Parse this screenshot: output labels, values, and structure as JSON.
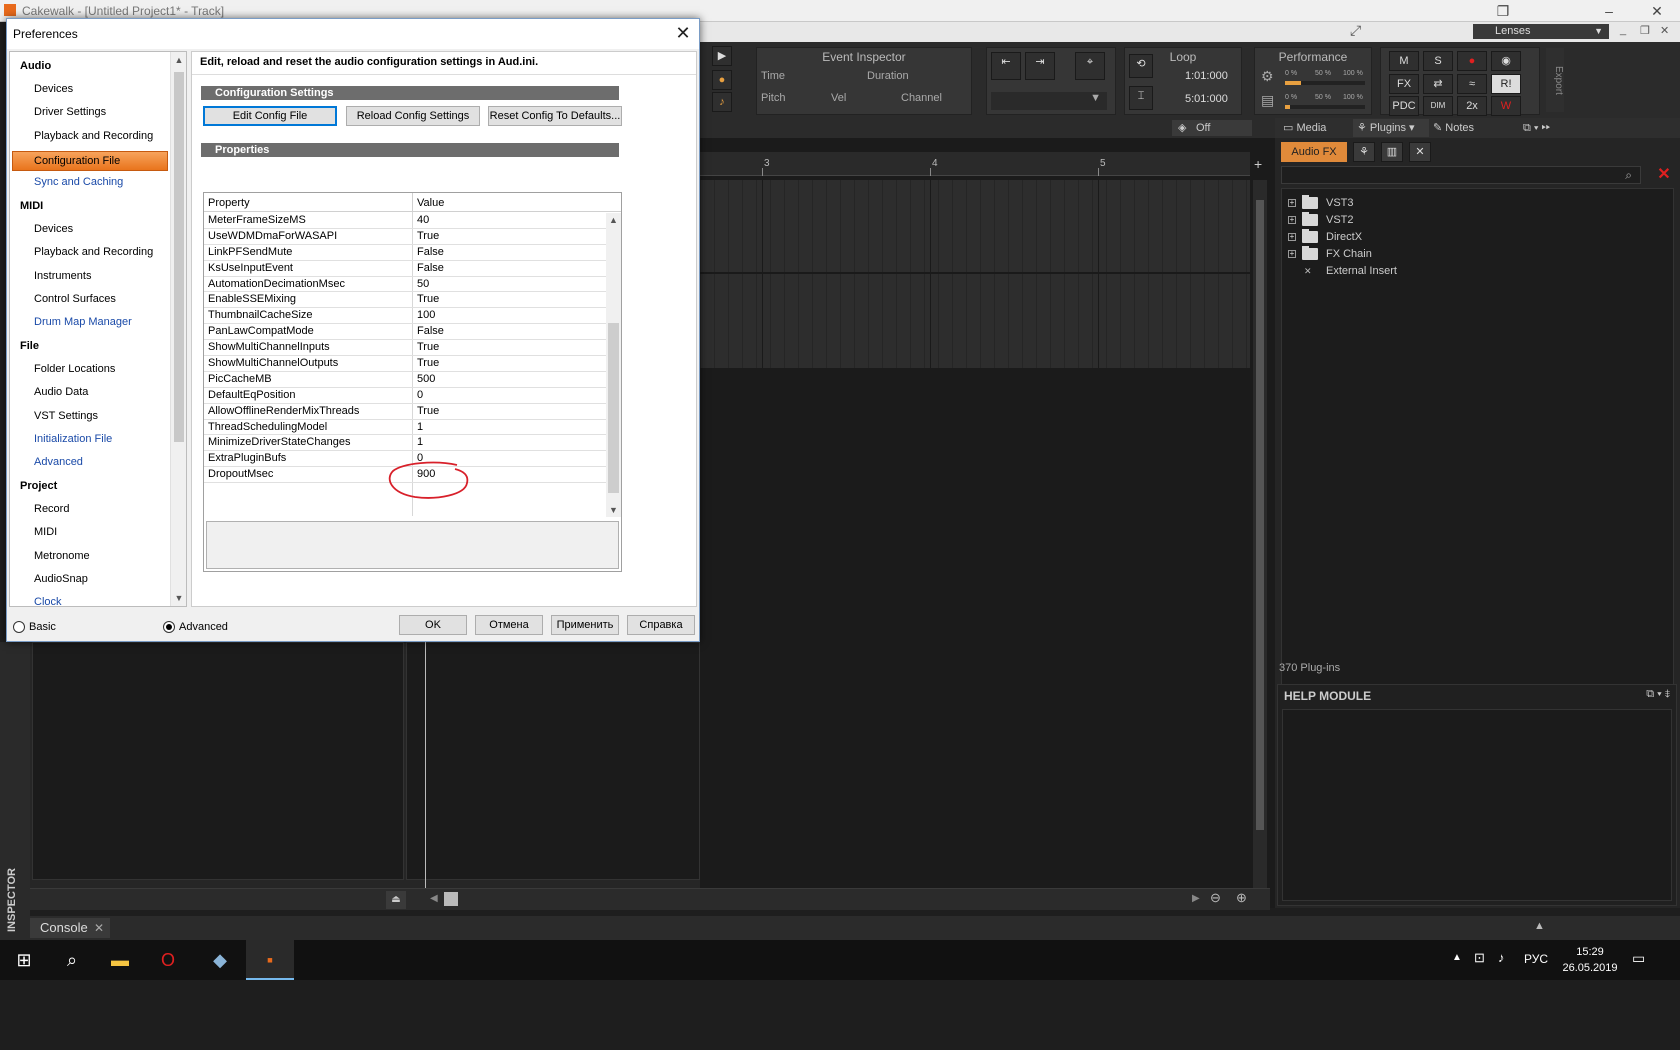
{
  "app": {
    "title": "Cakewalk - [Untitled Project1* - Track]",
    "lens_label": "Lenses",
    "export_label": "Export"
  },
  "controlbar": {
    "event_inspector": {
      "title": "Event Inspector",
      "time": "Time",
      "duration": "Duration",
      "pitch": "Pitch",
      "vel": "Vel",
      "channel": "Channel"
    },
    "loop": {
      "title": "Loop",
      "start": "1:01:000",
      "end": "5:01:000"
    },
    "performance": {
      "title": "Performance",
      "cpu1": "0 %",
      "cpu1_mid": "50 %",
      "cpu1_max": "100 %",
      "cpu2": "0 %",
      "cpu2_mid": "50 %",
      "cpu2_max": "100 %"
    },
    "mix": {
      "m": "M",
      "s": "S",
      "fx": "FX",
      "ri": "R!",
      "pdc": "PDC",
      "dim": "DIM",
      "x2": "2x"
    }
  },
  "track_view": {
    "off_label": "Off",
    "ruler": [
      "3",
      "4",
      "5"
    ]
  },
  "browser": {
    "tabs": [
      "Media",
      "Plugins",
      "Notes"
    ],
    "audio_fx": "Audio FX",
    "tree": [
      "VST3",
      "VST2",
      "DirectX",
      "FX Chain",
      "External Insert"
    ],
    "count": "370 Plug-ins",
    "help_title": "HELP MODULE"
  },
  "left": {
    "inspector_label": "INSPECTOR"
  },
  "console": {
    "tab": "Console"
  },
  "taskbar": {
    "lang": "РУС",
    "time": "15:29",
    "date": "26.05.2019"
  },
  "prefs": {
    "title": "Preferences",
    "nav": {
      "audio": "Audio",
      "audio_items": [
        "Devices",
        "Driver Settings",
        "Playback and Recording",
        "Configuration File",
        "Sync and Caching"
      ],
      "midi": "MIDI",
      "midi_items": [
        "Devices",
        "Playback and Recording",
        "Instruments",
        "Control Surfaces",
        "Drum Map Manager"
      ],
      "file": "File",
      "file_items": [
        "Folder Locations",
        "Audio Data",
        "VST Settings",
        "Initialization File",
        "Advanced"
      ],
      "project": "Project",
      "project_items": [
        "Record",
        "MIDI",
        "Metronome",
        "AudioSnap",
        "Clock"
      ]
    },
    "header": "Edit, reload and reset the audio configuration settings in Aud.ini.",
    "config_group": "Configuration Settings",
    "btn_edit": "Edit Config File",
    "btn_reload": "Reload Config Settings",
    "btn_reset": "Reset Config To Defaults...",
    "properties_group": "Properties",
    "col_property": "Property",
    "col_value": "Value",
    "rows": [
      {
        "k": "MeterFrameSizeMS",
        "v": "40"
      },
      {
        "k": "UseWDMDmaForWASAPI",
        "v": "True"
      },
      {
        "k": "LinkPFSendMute",
        "v": "False"
      },
      {
        "k": "KsUseInputEvent",
        "v": "False"
      },
      {
        "k": "AutomationDecimationMsec",
        "v": "50"
      },
      {
        "k": "EnableSSEMixing",
        "v": "True"
      },
      {
        "k": "ThumbnailCacheSize",
        "v": "100"
      },
      {
        "k": "PanLawCompatMode",
        "v": "False"
      },
      {
        "k": "ShowMultiChannelInputs",
        "v": "True"
      },
      {
        "k": "ShowMultiChannelOutputs",
        "v": "True"
      },
      {
        "k": "PicCacheMB",
        "v": "500"
      },
      {
        "k": "DefaultEqPosition",
        "v": "0"
      },
      {
        "k": "AllowOfflineRenderMixThreads",
        "v": "True"
      },
      {
        "k": "ThreadSchedulingModel",
        "v": "1"
      },
      {
        "k": "MinimizeDriverStateChanges",
        "v": "1"
      },
      {
        "k": "ExtraPluginBufs",
        "v": "0"
      },
      {
        "k": "DropoutMsec",
        "v": "900"
      }
    ],
    "radio_basic": "Basic",
    "radio_advanced": "Advanced",
    "selected_mode": "Advanced",
    "btn_ok": "OK",
    "btn_cancel": "Отмена",
    "btn_apply": "Применить",
    "btn_help": "Справка"
  },
  "colors": {
    "accent": "#e9741c",
    "annotation": "#d8202a"
  }
}
